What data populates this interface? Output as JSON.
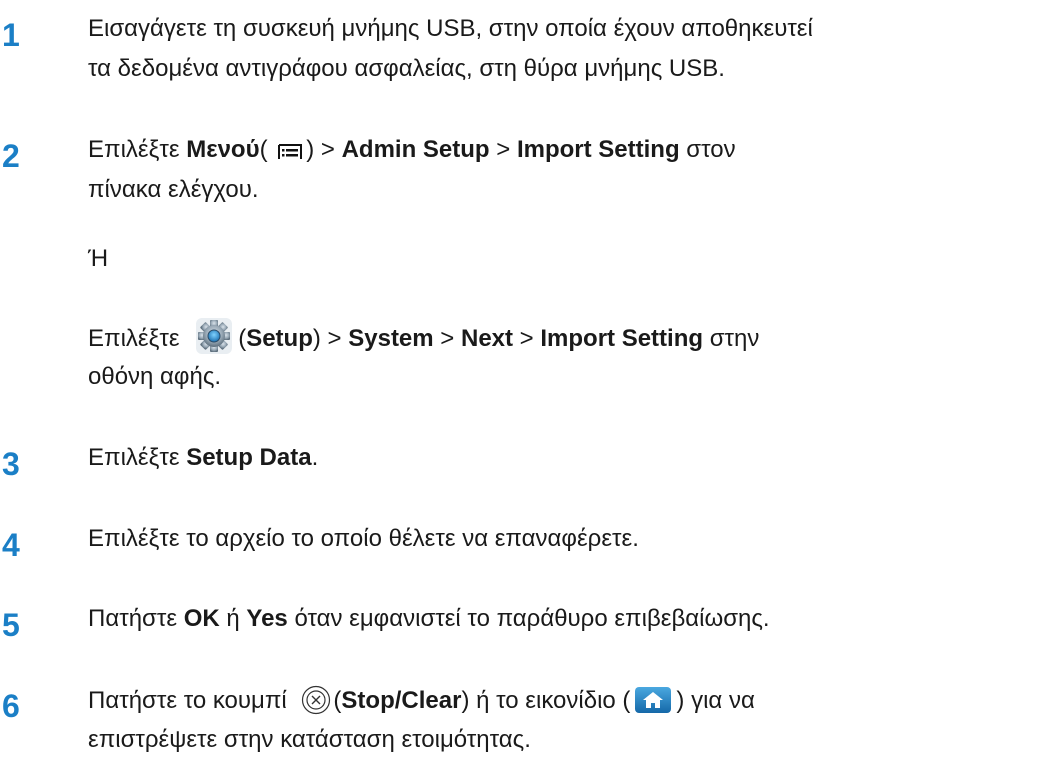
{
  "accent_color": "#1b7fc6",
  "steps": [
    {
      "number": "1",
      "line1": "Εισαγάγετε τη συσκευή μνήμης USB, στην οποία έχουν αποθηκευτεί",
      "line2": "τα δεδομένα αντιγράφου ασφαλείας, στη θύρα μνήμης USB."
    },
    {
      "number": "2",
      "pre": "Επιλέξτε ",
      "menu": "Μενού",
      "menu_open": "(",
      "menu_close": ")",
      "sep1": " > ",
      "admin": "Admin Setup",
      "sep2": " > ",
      "import": "Import Setting",
      "post": "  στον",
      "line2": "πίνακα ελέγχου.",
      "or": "Ή",
      "alt_pre": "Επιλέξτε",
      "alt_open": "(",
      "alt_setup": "Setup",
      "alt_close": ")",
      "alt_sep1": " > ",
      "alt_system": "System",
      "alt_sep2": " > ",
      "alt_next": "Next",
      "alt_sep3": " > ",
      "alt_import": "Import Setting",
      "alt_post": " στην",
      "alt_line2": "οθόνη αφής."
    },
    {
      "number": "3",
      "pre": "Επιλέξτε ",
      "bold": "Setup Data",
      "post": "."
    },
    {
      "number": "4",
      "line1": "Επιλέξτε το αρχείο το οποίο θέλετε να επαναφέρετε."
    },
    {
      "number": "5",
      "pre": "Πατήστε ",
      "ok": "OK",
      "mid": " ή ",
      "yes": "Yes",
      "post": "  όταν εμφανιστεί το παράθυρο επιβεβαίωσης."
    },
    {
      "number": "6",
      "pre": "Πατήστε το κουμπί",
      "open": "(",
      "stop": "Stop/Clear",
      "mid": ") ή το εικονίδιο (",
      "close": ") για να",
      "line2": "επιστρέψετε στην κατάσταση ετοιμότητας."
    }
  ],
  "icons": {
    "menu": "menu-icon",
    "setup": "gear-icon",
    "stop": "stop-clear-icon",
    "home": "home-icon"
  }
}
